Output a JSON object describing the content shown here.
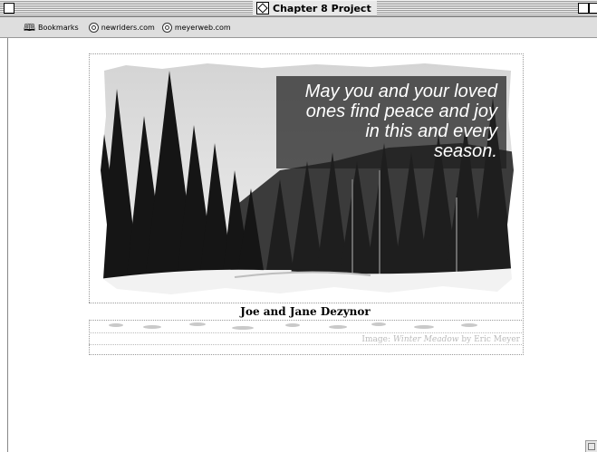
{
  "window": {
    "title": "Chapter 8 Project"
  },
  "toolbar": {
    "items": [
      {
        "label": "Bookmarks",
        "icon": "bookmarks-icon"
      },
      {
        "label": "newriders.com",
        "icon": "globe-icon"
      },
      {
        "label": "meyerweb.com",
        "icon": "globe-icon"
      }
    ]
  },
  "card": {
    "greeting": "May you and your loved\nones find peace and joy\nin this and every\nseason.",
    "names": "Joe and Jane Dezynor",
    "credit": {
      "prefix": "Image: ",
      "title": "Winter Meadow",
      "suffix": " by Eric Meyer"
    }
  },
  "colors": {
    "titlebar": "#e2e2e2",
    "toolbar": "#dedede",
    "credit_text": "#bbbbbb",
    "greeting_overlay": "#1e1e1e"
  }
}
